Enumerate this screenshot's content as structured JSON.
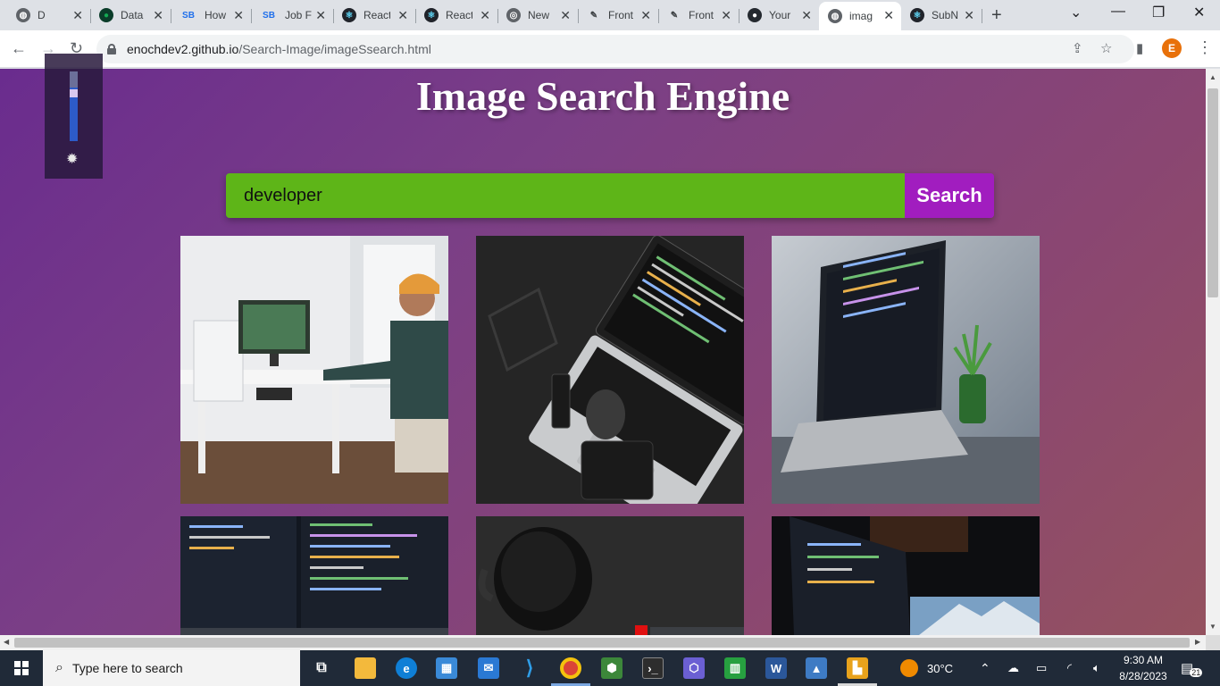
{
  "browser": {
    "tabs": [
      {
        "title": "D",
        "icon": "globe-icon",
        "color": "#5f6368"
      },
      {
        "title": "Data",
        "icon": "mongodb-leaf-icon",
        "color": "#13aa52"
      },
      {
        "title": "How",
        "icon": "storybook-icon",
        "color": "#1f6feb"
      },
      {
        "title": "Job F",
        "icon": "storybook-icon",
        "color": "#1f6feb"
      },
      {
        "title": "React",
        "icon": "react-icon",
        "color": "#61dafb"
      },
      {
        "title": "React",
        "icon": "react-icon",
        "color": "#61dafb"
      },
      {
        "title": "New",
        "icon": "chrome-icon",
        "color": "#5f6368"
      },
      {
        "title": "Front",
        "icon": "frontend-mentor-icon",
        "color": "#3c4043"
      },
      {
        "title": "Front",
        "icon": "frontend-mentor-icon",
        "color": "#3c4043"
      },
      {
        "title": "Your",
        "icon": "github-icon",
        "color": "#24292f"
      },
      {
        "title": "imag",
        "icon": "globe-icon",
        "color": "#5f6368",
        "active": true
      },
      {
        "title": "SubN",
        "icon": "react-icon",
        "color": "#61dafb"
      }
    ],
    "url_host": "enochdev2.github.io",
    "url_path": "/Search-Image/imageSsearch.html",
    "profile_initial": "E"
  },
  "page": {
    "title": "Image Search Engine",
    "search_value": "developer",
    "search_button": "Search",
    "colors": {
      "input_bg": "#5eb518",
      "button_bg": "#a11dbf"
    },
    "results": [
      {
        "alt": "man at desk with desktop PC and headphones"
      },
      {
        "alt": "laptop with code seen from above on dark desk"
      },
      {
        "alt": "laptop with code on table beside plant"
      },
      {
        "alt": "monitors with code in dark room"
      },
      {
        "alt": "coffee cup on dark surface"
      },
      {
        "alt": "monitor with code and mountain wallpaper"
      }
    ]
  },
  "taskbar": {
    "search_placeholder": "Type here to search",
    "weather": "30°C",
    "time": "9:30 AM",
    "date": "8/28/2023",
    "notifications": "21"
  }
}
